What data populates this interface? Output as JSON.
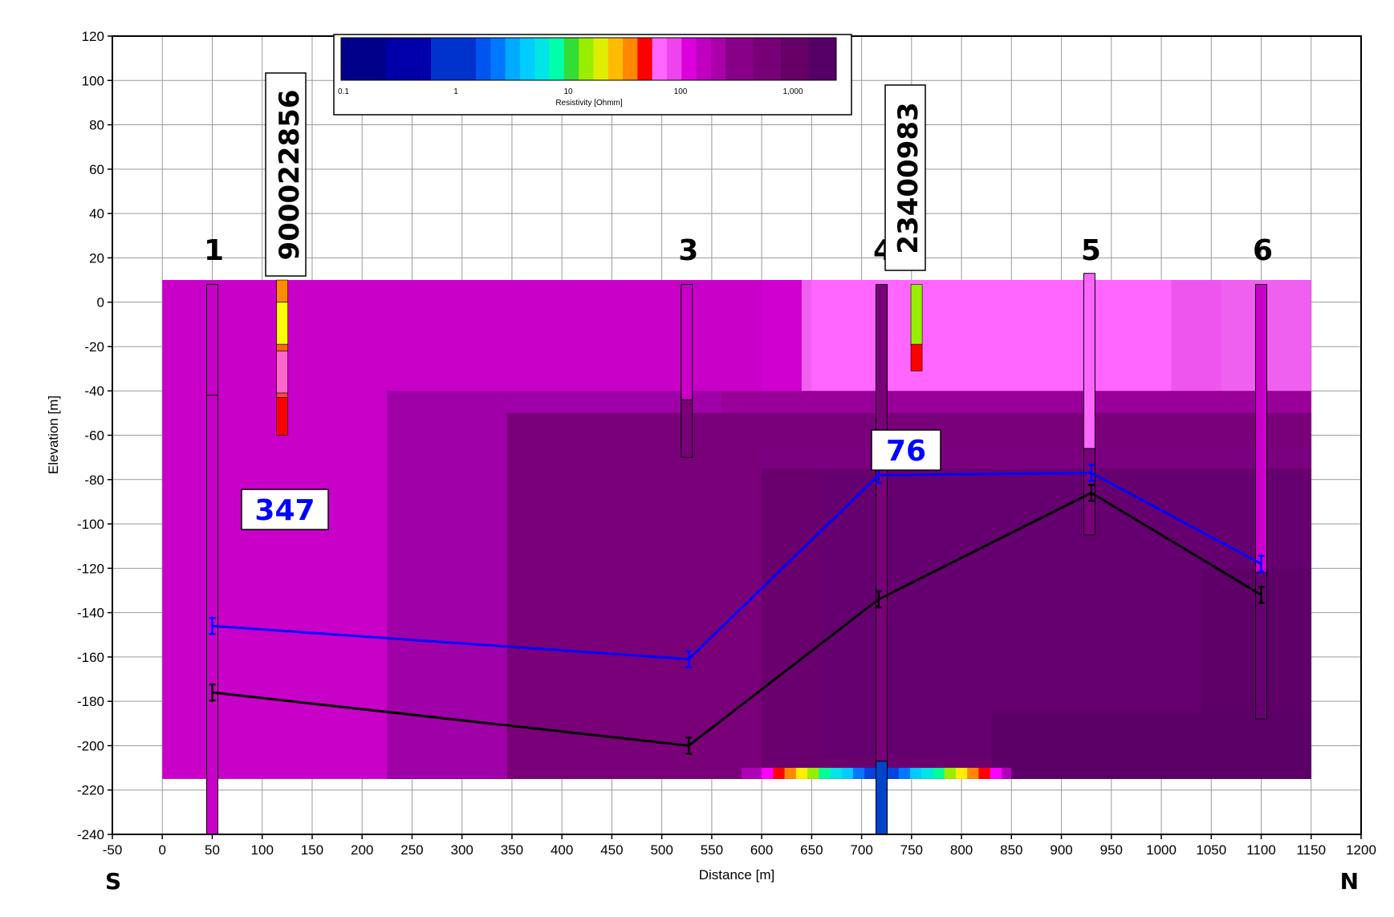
{
  "chart_data": {
    "type": "cross-section",
    "xlabel": "Distance [m]",
    "ylabel": "Elevation [m]",
    "xlim": [
      -50,
      1200
    ],
    "ylim": [
      -240,
      120
    ],
    "x_ticks": [
      -50,
      0,
      50,
      100,
      150,
      200,
      250,
      300,
      350,
      400,
      450,
      500,
      550,
      600,
      650,
      700,
      750,
      800,
      850,
      900,
      950,
      1000,
      1050,
      1100,
      1150,
      1200
    ],
    "y_ticks": [
      120,
      100,
      80,
      60,
      40,
      20,
      0,
      -20,
      -40,
      -60,
      -80,
      -100,
      -120,
      -140,
      -160,
      -180,
      -200,
      -220,
      -240
    ],
    "grid": true,
    "direction_left": "S",
    "direction_right": "N",
    "colorbar": {
      "label": "Resistivity [Ohmm]",
      "scale": "log",
      "ticks": [
        "0.1",
        "1",
        "10",
        "100",
        "1,000"
      ],
      "colors": [
        "#00008b",
        "#0000aa",
        "#0033cc",
        "#0055ee",
        "#0077ff",
        "#00aaff",
        "#00ccff",
        "#00e5e5",
        "#00ffaa",
        "#33dd33",
        "#99ee00",
        "#ddee00",
        "#ffbb00",
        "#ff8800",
        "#ff0000",
        "#ff66ff",
        "#ee44ee",
        "#dd00dd",
        "#c000c0",
        "#aa00aa",
        "#880088",
        "#770077",
        "#660066",
        "#550066"
      ]
    },
    "soundings": [
      {
        "label": "1",
        "x": 50
      },
      {
        "label": "3",
        "x": 525
      },
      {
        "label": "4",
        "x": 720
      },
      {
        "label": "5",
        "x": 928
      },
      {
        "label": "6",
        "x": 1100
      }
    ],
    "boreholes": [
      {
        "id": "900022856",
        "x": 120,
        "top": 10,
        "bottom": -60
      },
      {
        "id": "23400983",
        "x": 755,
        "top": 8,
        "bottom": -32
      }
    ],
    "value_labels": [
      {
        "text": "347",
        "color": "#0000ff"
      },
      {
        "text": "76",
        "color": "#0000ff"
      }
    ],
    "series": [
      {
        "color": "#0000ff",
        "x": [
          50,
          527,
          717,
          930,
          1100
        ],
        "y": [
          -146,
          -161,
          -78,
          -77,
          -118
        ]
      },
      {
        "color": "#000000",
        "x": [
          50,
          527,
          717,
          930,
          1100
        ],
        "y": [
          -176,
          -200,
          -134,
          -86,
          -132
        ]
      }
    ]
  }
}
